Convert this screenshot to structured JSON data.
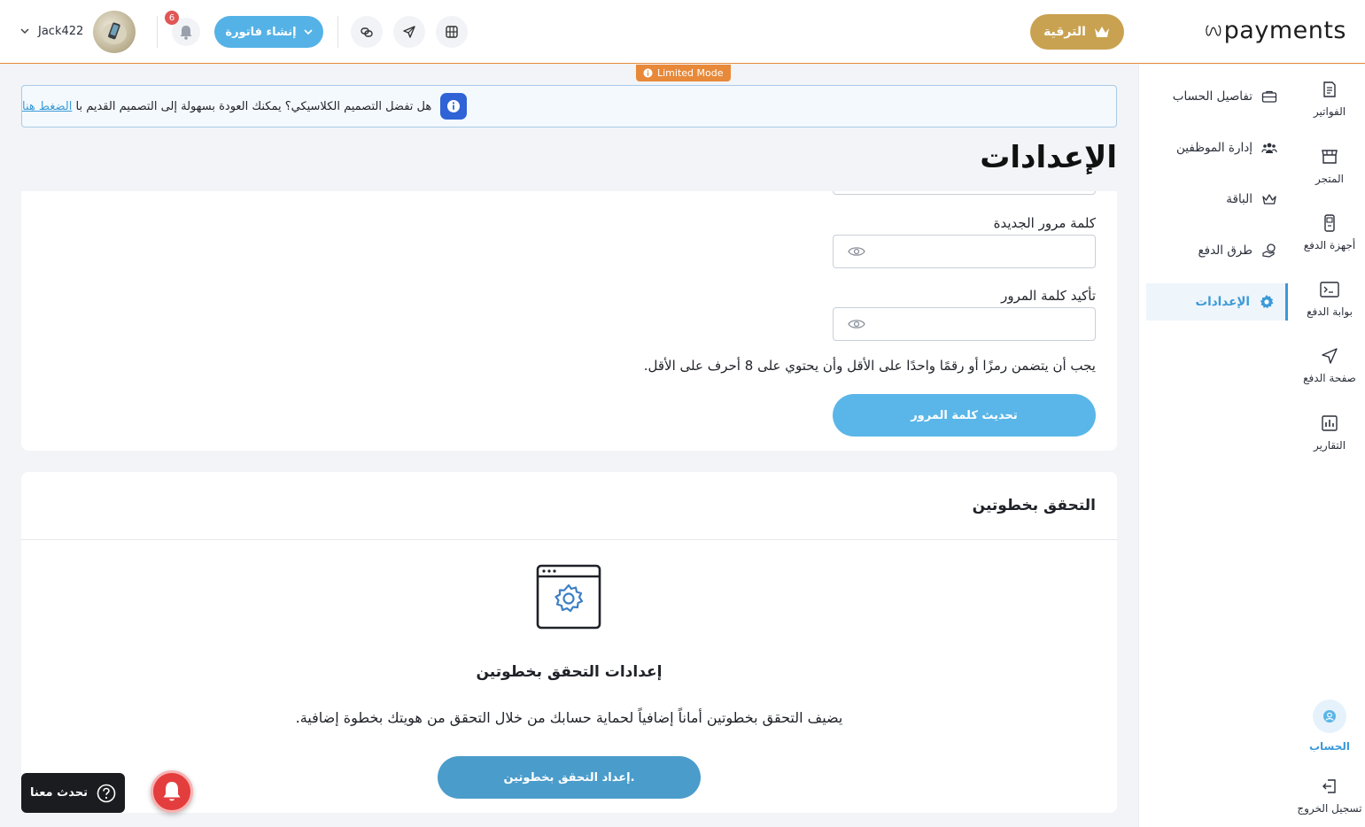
{
  "header": {
    "brand": "payments",
    "upgrade_label": "الترقية",
    "create_invoice_label": "إنشاء فاتورة",
    "notification_count": "6",
    "username": "Jack422"
  },
  "limited_mode": "Limited Mode",
  "notice": {
    "text": "هل تفضل التصميم الكلاسيكي؟ يمكنك العودة بسهولة إلى التصميم القديم با",
    "link": "الضغط هنا"
  },
  "page_title": "الإعدادات",
  "rail": {
    "items": [
      {
        "label": "الفواتير",
        "icon": "invoice-icon"
      },
      {
        "label": "المتجر",
        "icon": "store-icon"
      },
      {
        "label": "أجهزة الدفع",
        "icon": "pos-device-icon"
      },
      {
        "label": "بوابة الدفع",
        "icon": "terminal-icon"
      },
      {
        "label": "صفحة الدفع",
        "icon": "send-icon"
      },
      {
        "label": "التقارير",
        "icon": "chart-icon"
      }
    ],
    "account": "الحساب",
    "logout": "تسجيل الخروج"
  },
  "subnav": {
    "items": [
      {
        "label": "تفاصيل الحساب",
        "icon": "briefcase-icon"
      },
      {
        "label": "إدارة الموظفين",
        "icon": "users-icon"
      },
      {
        "label": "الباقة",
        "icon": "crown-icon"
      },
      {
        "label": "طرق الدفع",
        "icon": "coins-icon"
      },
      {
        "label": "الإعدادات",
        "icon": "gear-icon",
        "active": true
      }
    ]
  },
  "password": {
    "new_label": "كلمة مرور الجديدة",
    "confirm_label": "تأكيد كلمة المرور",
    "hint": "يجب أن يتضمن رمزًا أو رقمًا واحدًا على الأقل وأن يحتوي على 8 أحرف على الأقل.",
    "update_button": "تحديث كلمة المرور"
  },
  "two_factor": {
    "section_title": "التحقق بخطوتين",
    "heading": "إعدادات التحقق بخطوتين",
    "description": "يضيف التحقق بخطوتين أماناً إضافياً لحماية حسابك من خلال التحقق من هويتك بخطوة إضافية.",
    "button": "إعداد التحقق بخطوتين."
  },
  "chat_label": "تحدث معنا",
  "colors": {
    "accent": "#55b2e6",
    "upgrade": "#c9a251",
    "limited": "#e8893a",
    "danger": "#e43d3d"
  }
}
